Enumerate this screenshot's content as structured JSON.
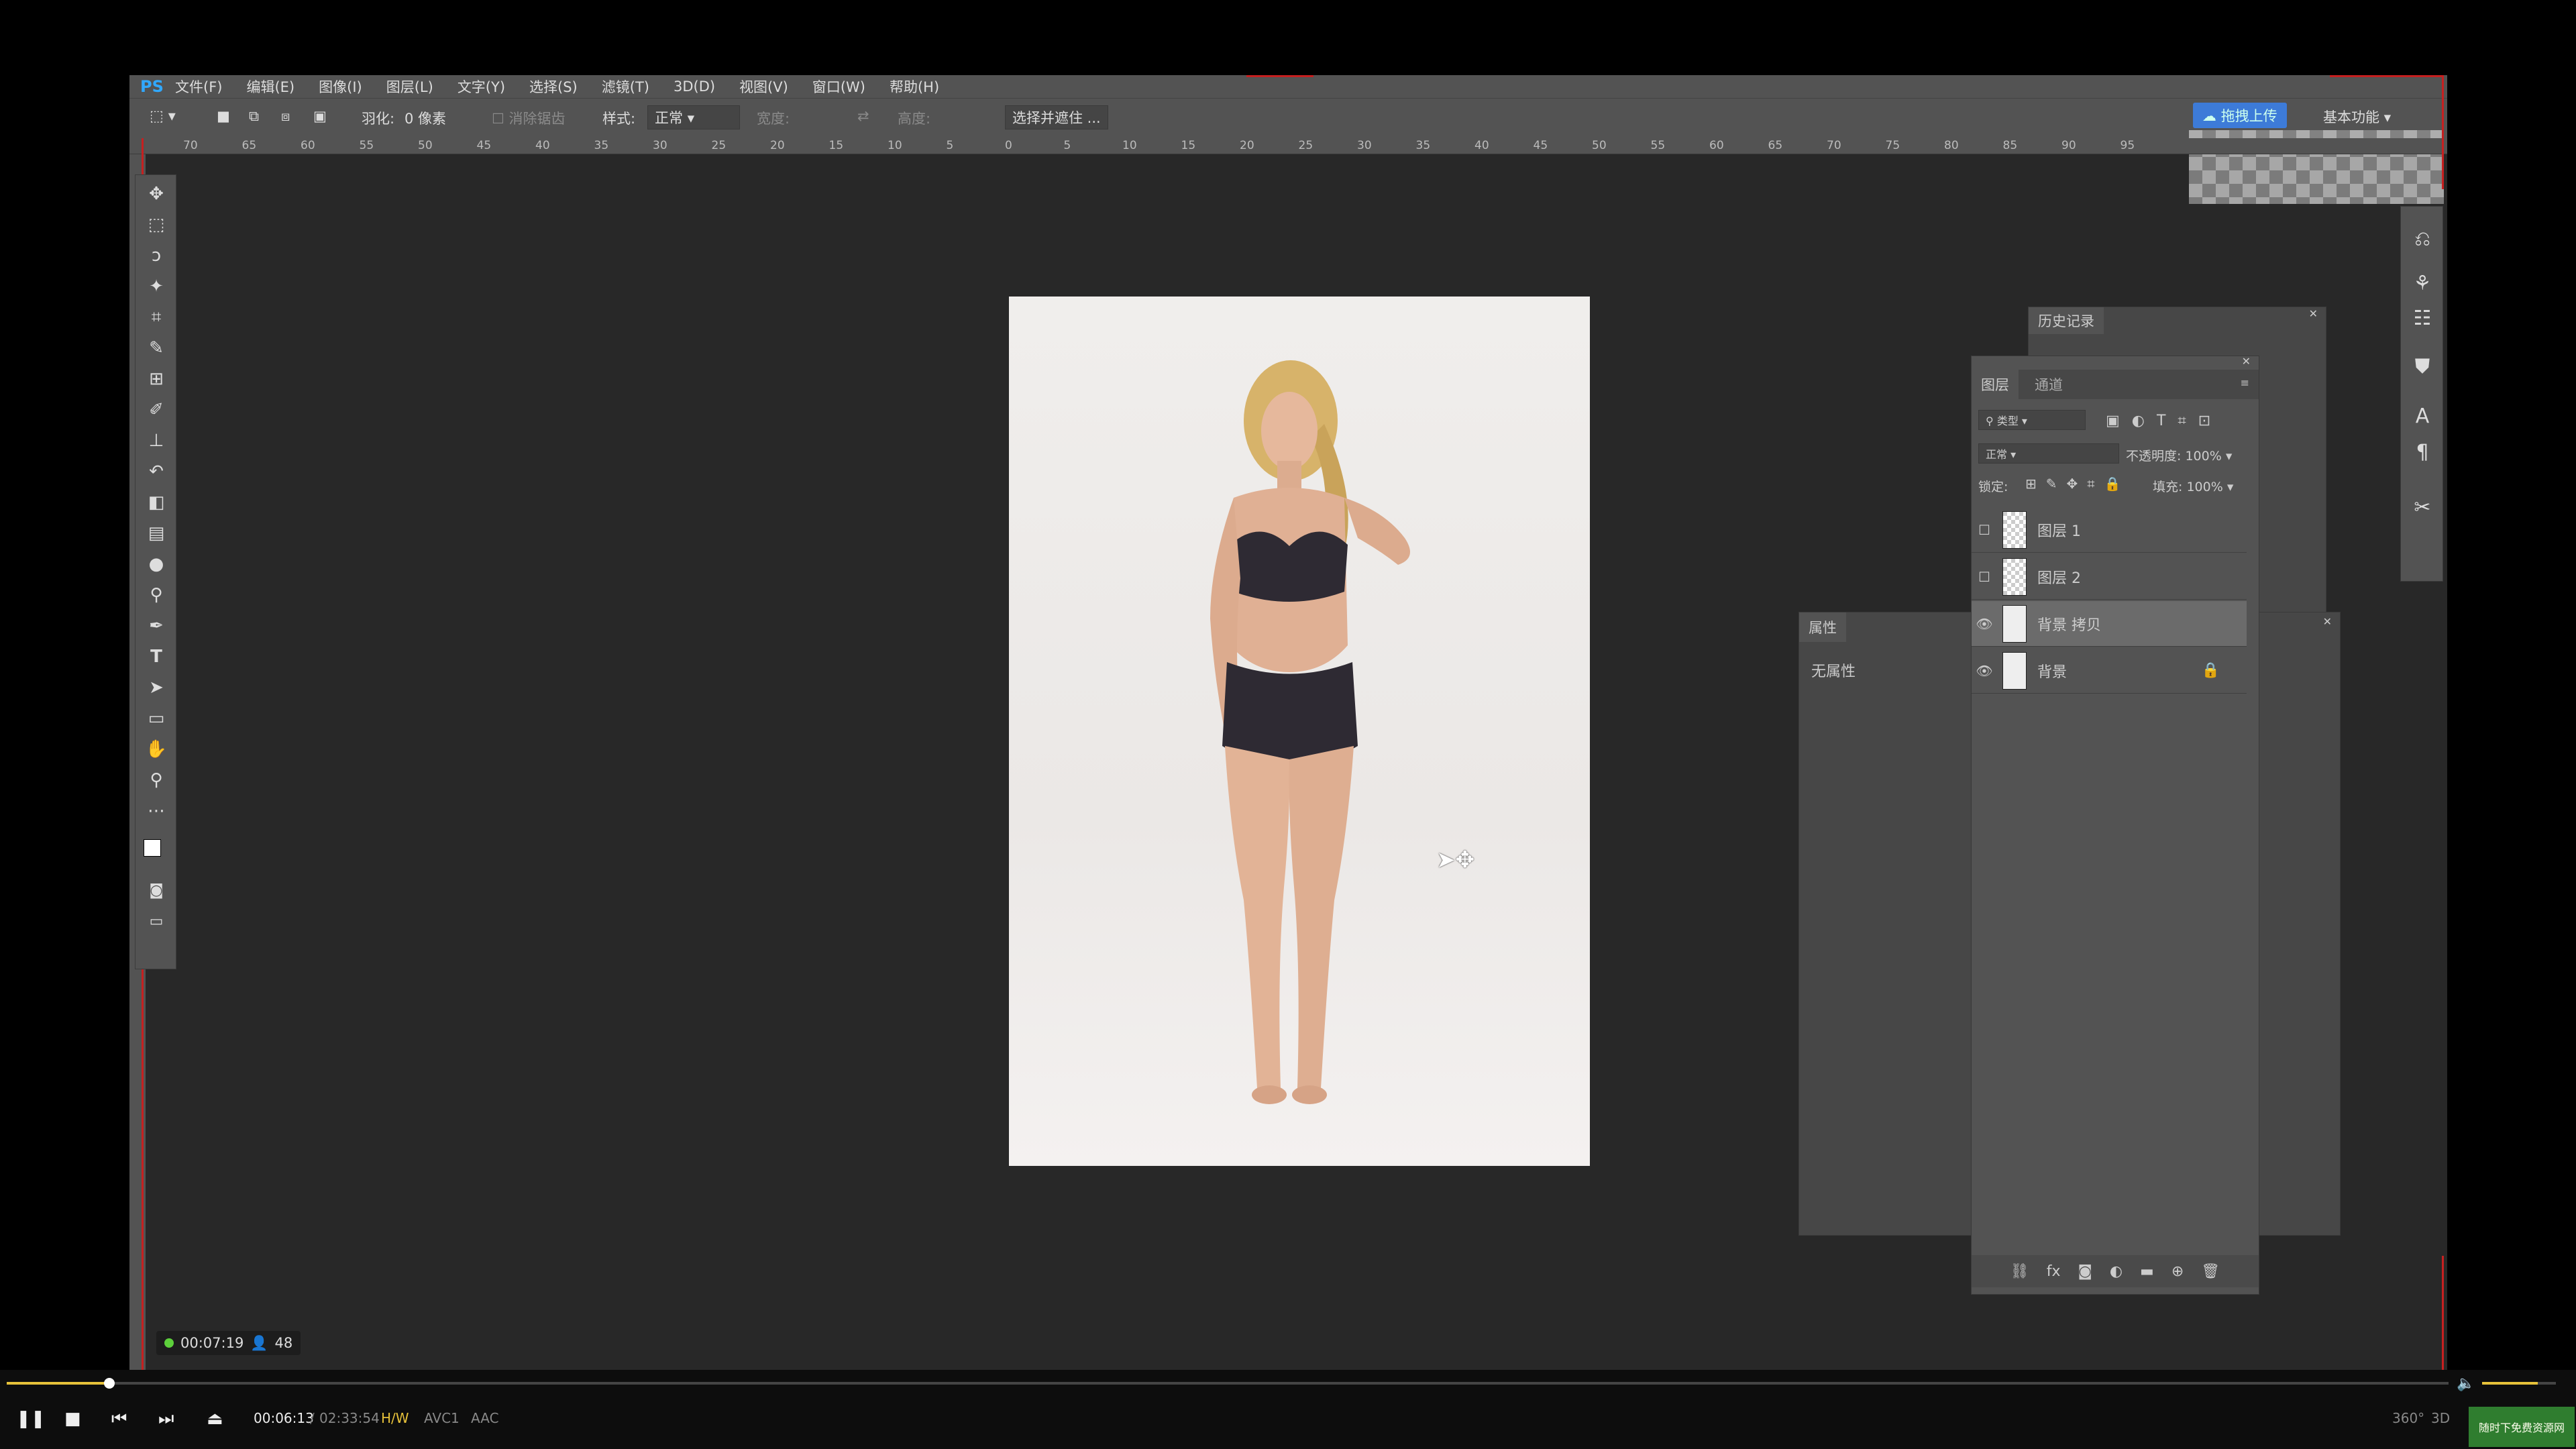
{
  "app": {
    "logo": "PS"
  },
  "menu": [
    "文件(F)",
    "编辑(E)",
    "图像(I)",
    "图层(L)",
    "文字(Y)",
    "选择(S)",
    "滤镜(T)",
    "3D(D)",
    "视图(V)",
    "窗口(W)",
    "帮助(H)"
  ],
  "options": {
    "feather_label": "羽化:",
    "feather_value": "0 像素",
    "antialias": "消除锯齿",
    "style_label": "样式:",
    "style_value": "正常",
    "width_label": "宽度:",
    "height_label": "高度:",
    "select_mask": "选择并遮住 ...",
    "upload_btn": "拖拽上传",
    "workspace": "基本功能"
  },
  "ruler_ticks": [
    "70",
    "65",
    "60",
    "55",
    "50",
    "45",
    "40",
    "35",
    "30",
    "25",
    "20",
    "15",
    "10",
    "5",
    "0",
    "5",
    "10",
    "15",
    "20",
    "25",
    "30",
    "35",
    "40",
    "45",
    "50",
    "55",
    "60",
    "65",
    "70",
    "75",
    "80",
    "85",
    "90",
    "95"
  ],
  "history_panel": {
    "title": "历史记录"
  },
  "properties_panel": {
    "title": "属性",
    "content": "无属性"
  },
  "layers_panel": {
    "tabs": [
      "图层",
      "通道"
    ],
    "filter_kind": "类型",
    "blend_mode": "正常",
    "opacity_label": "不透明度:",
    "opacity_value": "100%",
    "lock_label": "锁定:",
    "fill_label": "填充:",
    "fill_value": "100%",
    "layers": [
      {
        "name": "图层 1",
        "visible": false,
        "selected": false,
        "locked": false
      },
      {
        "name": "图层 2",
        "visible": false,
        "selected": false,
        "locked": false
      },
      {
        "name": "背景 拷贝",
        "visible": true,
        "selected": true,
        "locked": false
      },
      {
        "name": "背景",
        "visible": true,
        "selected": false,
        "locked": true
      }
    ]
  },
  "stream_overlay": {
    "time": "00:07:19",
    "viewers": "48"
  },
  "player": {
    "current": "00:06:13",
    "separator": "/",
    "total": "02:33:54",
    "hw": "H/W",
    "vcodec": "AVC1",
    "acodec": "AAC",
    "mode360": "360°",
    "mode3d": "3D",
    "progress": 0.042,
    "volume": 0.75,
    "watermark": "随时下免费资源网"
  }
}
